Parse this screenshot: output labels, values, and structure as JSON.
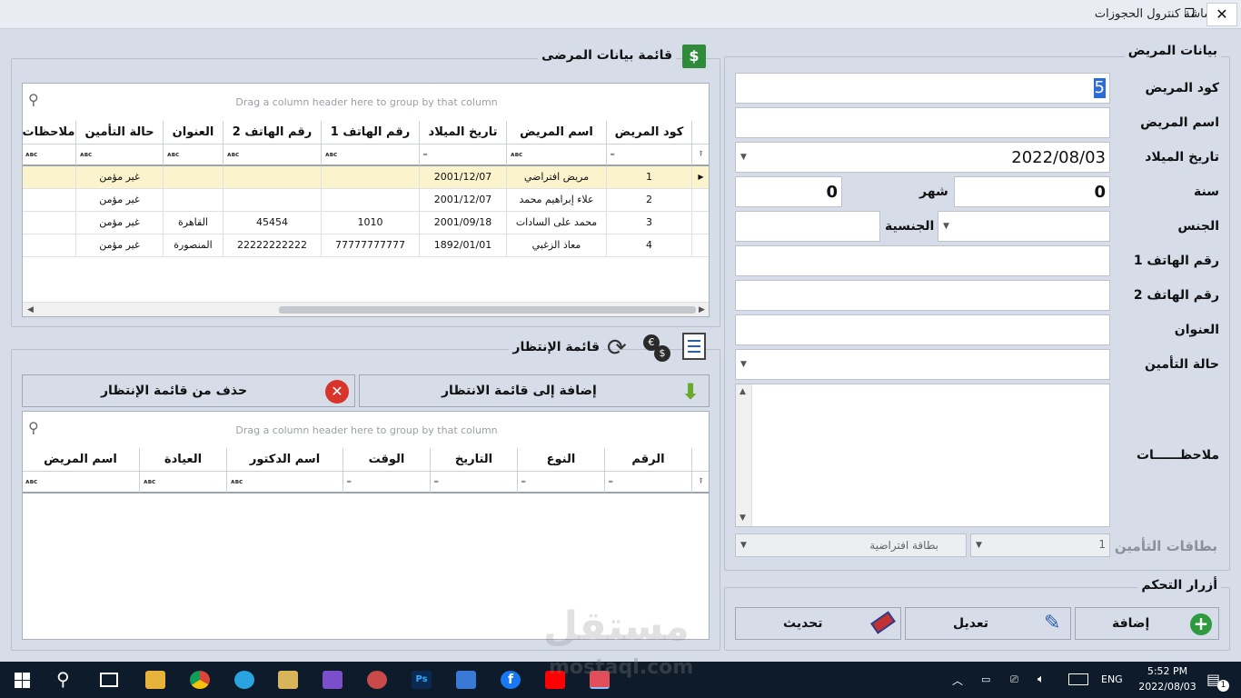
{
  "window": {
    "title": "شاشة كنترول الحجوزات"
  },
  "patient_form": {
    "group_title": "بيانات المريض",
    "labels": {
      "code": "كود المريض",
      "name": "اسم المريض",
      "birth_date": "تاريخ الميلاد",
      "year": "سنة",
      "month": "شهر",
      "gender": "الجنس",
      "nationality": "الجنسية",
      "phone1": "رقم الهاتف 1",
      "phone2": "رقم الهاتف 2",
      "address": "العنوان",
      "insurance_status": "حالة التأمين",
      "notes": "ملاحظــــــات",
      "insurance_cards": "بطاقات التأمين"
    },
    "values": {
      "code": "5",
      "name": "",
      "birth_date": "2022/08/03",
      "year": "0",
      "month": "0",
      "gender": "",
      "nationality": "",
      "phone1": "",
      "phone2": "",
      "address": "",
      "insurance_status": "",
      "notes": "",
      "card_number": "1",
      "card_type": "بطاقة افتراضية"
    }
  },
  "controls": {
    "group_title": "أزرار التحكم",
    "add_label": "إضافة",
    "edit_label": "تعديل",
    "refresh_label": "تحديث"
  },
  "patients_list": {
    "group_title": "قائمة بيانات المرضى",
    "group_hint": "Drag a column header here to group by that column",
    "columns": [
      "كود المريض",
      "اسم المريض",
      "تاريخ الميلاد",
      "رقم الهاتف 1",
      "رقم الهاتف 2",
      "العنوان",
      "حالة التأمين",
      "ملاحظات"
    ],
    "rows": [
      [
        "1",
        "مريض افتراضي",
        "2001/12/07",
        "",
        "",
        "",
        "غير مؤمن",
        ""
      ],
      [
        "2",
        "علاء إبراهيم محمد",
        "2001/12/07",
        "",
        "",
        "",
        "غير مؤمن",
        ""
      ],
      [
        "3",
        "محمد على السادات",
        "2001/09/18",
        "1010",
        "45454",
        "القاهرة",
        "غير مؤمن",
        ""
      ],
      [
        "4",
        "معاذ الزغبي",
        "1892/01/01",
        "77777777777",
        "22222222222",
        "المنصورة",
        "غير مؤمن",
        ""
      ]
    ]
  },
  "waiting_list": {
    "group_title": "قائمة الإنتظار",
    "add_label": "إضافة إلى قائمة الانتظار",
    "remove_label": "حذف من قائمة الإنتظار",
    "group_hint": "Drag a column header here to group by that column",
    "columns": [
      "الرقم",
      "النوع",
      "التاريخ",
      "الوقت",
      "اسم الدكتور",
      "العيادة",
      "اسم المريض"
    ]
  },
  "watermark": {
    "brand": "مستقل",
    "url": "mostaql.com"
  },
  "taskbar": {
    "language": "ENG",
    "time": "5:52 PM",
    "date": "2022/08/03",
    "notification_count": "1"
  },
  "colors": {
    "background": "#d6dde9",
    "selected_row": "#fbf3cc",
    "taskbar": "#0e1b2a",
    "add_icon": "#2e9a3e",
    "remove_icon": "#d9342b",
    "edit_icon": "#2a5fb0"
  }
}
